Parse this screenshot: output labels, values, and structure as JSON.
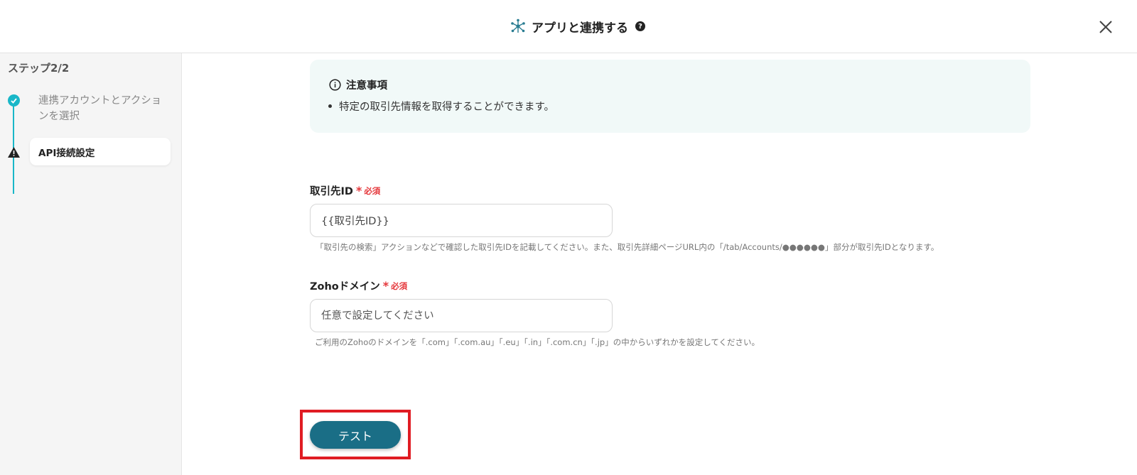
{
  "header": {
    "title": "アプリと連携する",
    "help_glyph": "?",
    "close_label": "×"
  },
  "sidebar": {
    "step_heading": "ステップ2/2",
    "steps": [
      {
        "label": "連携アカウントとアクションを選択",
        "status": "completed"
      },
      {
        "label": "API接続設定",
        "status": "current-warning"
      }
    ]
  },
  "notice": {
    "title": "注意事項",
    "items": [
      "特定の取引先情報を取得することができます。"
    ]
  },
  "fields": [
    {
      "label": "取引先ID",
      "required_star": "*",
      "required_text": "必須",
      "value": "{{取引先ID}}",
      "placeholder": "",
      "hint": "「取引先の検索」アクションなどで確認した取引先IDを記載してください。また、取引先詳細ページURL内の「/tab/Accounts/●●●●●●」部分が取引先IDとなります。"
    },
    {
      "label": "Zohoドメイン",
      "required_star": "*",
      "required_text": "必須",
      "value": "",
      "placeholder": "任意で設定してください",
      "hint": "ご利用のZohoのドメインを「.com」「.com.au」「.eu」「.in」「.com.cn」「.jp」の中からいずれかを設定してください。"
    }
  ],
  "actions": {
    "test_label": "テスト"
  },
  "colors": {
    "accent_teal": "#19b7c8",
    "button_primary": "#1a6e86",
    "required_red": "#e5373b",
    "highlight_red": "#e01c23",
    "notice_bg": "#f1f9f8"
  }
}
